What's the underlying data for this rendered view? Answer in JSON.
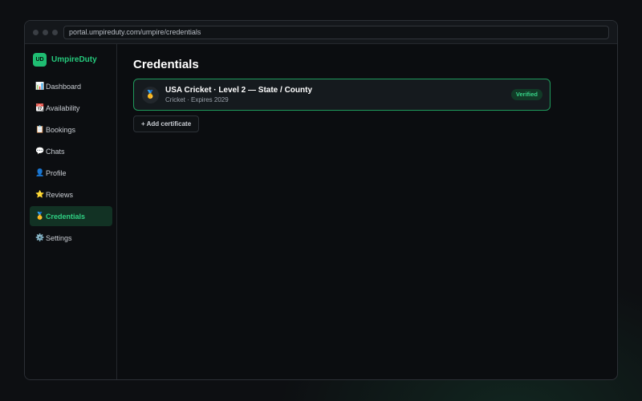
{
  "browser": {
    "url": "portal.umpireduty.com/umpire/credentials"
  },
  "brand": {
    "logo": "UD",
    "name": "UmpireDuty"
  },
  "sidebar": {
    "items": [
      {
        "icon": "📊",
        "label": "Dashboard"
      },
      {
        "icon": "📆",
        "label": "Availability"
      },
      {
        "icon": "📋",
        "label": "Bookings"
      },
      {
        "icon": "💬",
        "label": "Chats"
      },
      {
        "icon": "👤",
        "label": "Profile"
      },
      {
        "icon": "⭐",
        "label": "Reviews"
      },
      {
        "icon": "🥇",
        "label": "Credentials",
        "active": true
      },
      {
        "icon": "⚙️",
        "label": "Settings"
      }
    ]
  },
  "main": {
    "title": "Credentials",
    "certificate": {
      "icon": "🥇",
      "title": "USA Cricket · Level 2 — State / County",
      "subtitle": "Cricket · Expires 2029",
      "status": "Verified"
    },
    "add_button_label": "+ Add certificate"
  },
  "colors": {
    "accent": "#1fbd72",
    "active_bg": "#123224",
    "card_border": "#1f9a5c",
    "background": "#0d0f12"
  }
}
